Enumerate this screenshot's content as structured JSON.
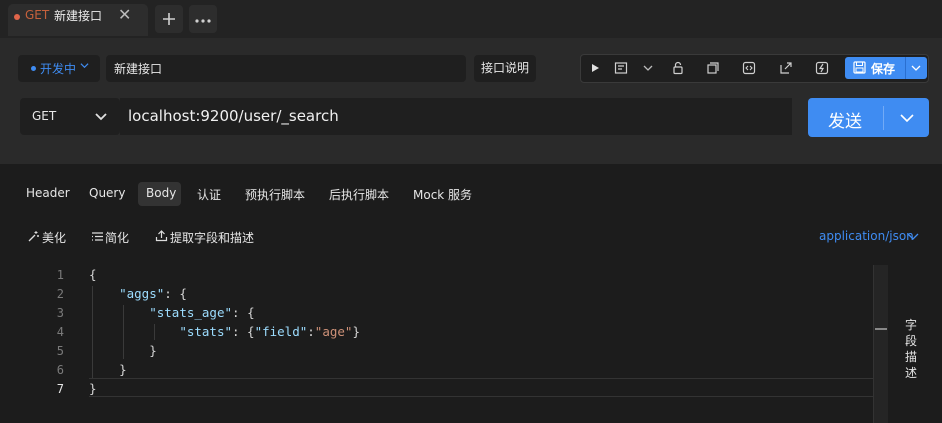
{
  "tab": {
    "method": "GET",
    "name": "新建接口"
  },
  "env": {
    "label": "开发中"
  },
  "request": {
    "name": "新建接口",
    "doc_label": "接口说明",
    "method": "GET",
    "url": "localhost:9200/user/_search"
  },
  "toolbar": {
    "save_label": "保存"
  },
  "send": {
    "label": "发送"
  },
  "subtabs": [
    "Header",
    "Query",
    "Body",
    "认证",
    "预执行脚本",
    "后执行脚本",
    "Mock 服务"
  ],
  "body_tools": {
    "beautify": "美化",
    "simplify": "简化",
    "extract": "提取字段和描述",
    "content_type": "application/json"
  },
  "editor": {
    "line_numbers": [
      "1",
      "2",
      "3",
      "4",
      "5",
      "6",
      "7"
    ],
    "tokens": {
      "aggs": "\"aggs\"",
      "stats_age": "\"stats_age\"",
      "stats": "\"stats\"",
      "field": "\"field\"",
      "age": "\"age\""
    }
  },
  "side_label": "字段描述",
  "colors": {
    "accent": "#3f8cf2",
    "method_get": "#c6613c",
    "tab_dot": "#e0654a"
  }
}
